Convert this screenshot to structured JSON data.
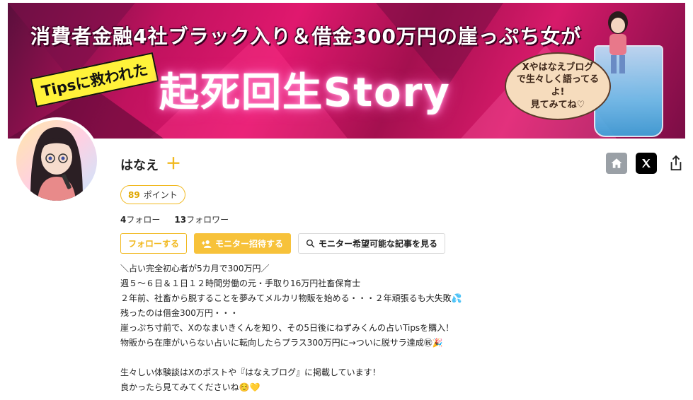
{
  "banner": {
    "title": "消費者金融4社ブラック入り＆借金300万円の崖っぷち女が",
    "tag": "Tipsに救われた",
    "headline": "起死回生Story",
    "bubble": "Xやはなえブログ\nで生々しく語ってるよ!\n見てみてね♡"
  },
  "profile": {
    "name": "はなえ",
    "points_value": "89",
    "points_label": "ポイント",
    "follow_count": "4",
    "follow_label": "フォロー",
    "follower_count": "13",
    "follower_label": "フォロワー"
  },
  "buttons": {
    "follow": "フォローする",
    "invite": "モニター招待する",
    "articles": "モニター希望可能な記事を見る"
  },
  "bio": [
    "＼占い完全初心者が5カ月で300万円／",
    "週５～６日＆１日１２時間労働の元・手取り16万円社畜保育士",
    "２年前、社畜から脱することを夢みてメルカリ物販を始める・・・２年頑張るも大失敗💦",
    "残ったのは借金300万円・・・",
    "崖っぷち寸前で、Xのなまいきくんを知り、その5日後にねずみくんの占いTipsを購入！",
    "物販から在庫がいらない占いに転向したらプラス300万円に→ついに脱サラ達成㊗🎉",
    "",
    "生々しい体験談はXのポストや『はなえブログ』に掲載しています！",
    "良かったら見てみてくださいね☺️💛"
  ],
  "colors": {
    "accent": "#f1b81d",
    "invite_bg": "#f7c23a",
    "banner_pink": "#e0186e"
  },
  "icons": [
    "plus-icon",
    "home-icon",
    "x-logo-icon",
    "share-icon",
    "add-user-icon",
    "search-icon"
  ]
}
